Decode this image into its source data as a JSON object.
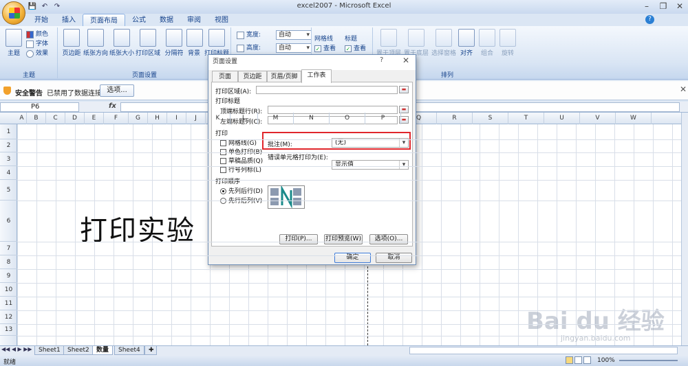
{
  "window": {
    "title": "excel2007 - Microsoft Excel",
    "minimize": "–",
    "restore": "❐",
    "close": "✕"
  },
  "qat": {
    "save": "💾",
    "undo": "↶",
    "redo": "↷"
  },
  "tabs": [
    "开始",
    "插入",
    "页面布局",
    "公式",
    "数据",
    "审阅",
    "视图"
  ],
  "active_tab": "页面布局",
  "ribbon": {
    "theme_group": {
      "label": "主题",
      "theme_btn": "主题",
      "colors": "颜色",
      "fonts": "字体",
      "effects": "效果"
    },
    "page_setup_group": {
      "label": "页面设置",
      "buttons": [
        "页边距",
        "纸张方向",
        "纸张大小",
        "打印区域",
        "分隔符",
        "背景",
        "打印标题"
      ]
    },
    "scale_group": {
      "width_label": "宽度:",
      "width_val": "自动",
      "height_label": "高度:",
      "height_val": "自动"
    },
    "sheet_options": {
      "gridlines": "网格线",
      "headings": "标题",
      "view1": "查看",
      "view2": "查看"
    },
    "arrange_group": {
      "label": "排列",
      "buttons": [
        "置于顶层",
        "置于底层",
        "选择窗格",
        "对齐",
        "组合",
        "旋转"
      ]
    }
  },
  "security_bar": {
    "warning": "安全警告",
    "message": "已禁用了数据连接",
    "options_btn": "选项...",
    "close": "✕"
  },
  "formula_bar": {
    "name_box": "P6",
    "fx": "fx"
  },
  "columns": [
    "A",
    "B",
    "C",
    "D",
    "E",
    "F",
    "G",
    "H",
    "I",
    "J",
    "K",
    "L",
    "M",
    "N",
    "O",
    "P",
    "Q",
    "R",
    "S",
    "T",
    "U",
    "V",
    "W"
  ],
  "rows": [
    "1",
    "2",
    "3",
    "4",
    "5",
    "6",
    "7",
    "8",
    "9",
    "10",
    "11",
    "12",
    "13"
  ],
  "cell_text": "打印实验",
  "sheets": [
    "Sheet1",
    "Sheet2",
    "数量",
    "Sheet4"
  ],
  "active_sheet": "数量",
  "status": {
    "ready": "就绪",
    "zoom": "100%"
  },
  "dialog": {
    "title": "页面设置",
    "help": "?",
    "close": "✕",
    "tabs": [
      "页面",
      "页边距",
      "页眉/页脚",
      "工作表"
    ],
    "active_tab": "工作表",
    "print_area_label": "打印区域(A):",
    "print_titles_label": "打印标题",
    "top_rows_label": "顶端标题行(R):",
    "left_cols_label": "左端标题列(C):",
    "print_section_label": "打印",
    "checkboxes": [
      "网格线(G)",
      "单色打印(B)",
      "草稿品质(Q)",
      "行号列标(L)"
    ],
    "comments_label": "批注(M):",
    "comments_value": "(无)",
    "errors_label": "错误单元格打印为(E):",
    "errors_value": "显示值",
    "order_label": "打印顺序",
    "order_options": [
      "先列后行(D)",
      "先行后列(V)"
    ],
    "order_selected": "先列后行(D)",
    "print_btn": "打印(P)...",
    "preview_btn": "打印预览(W)",
    "options_btn": "选项(O)...",
    "ok_btn": "确定",
    "cancel_btn": "取消"
  },
  "watermark": {
    "brand": "Bai du 经验",
    "url": "jingyan.baidu.com"
  }
}
